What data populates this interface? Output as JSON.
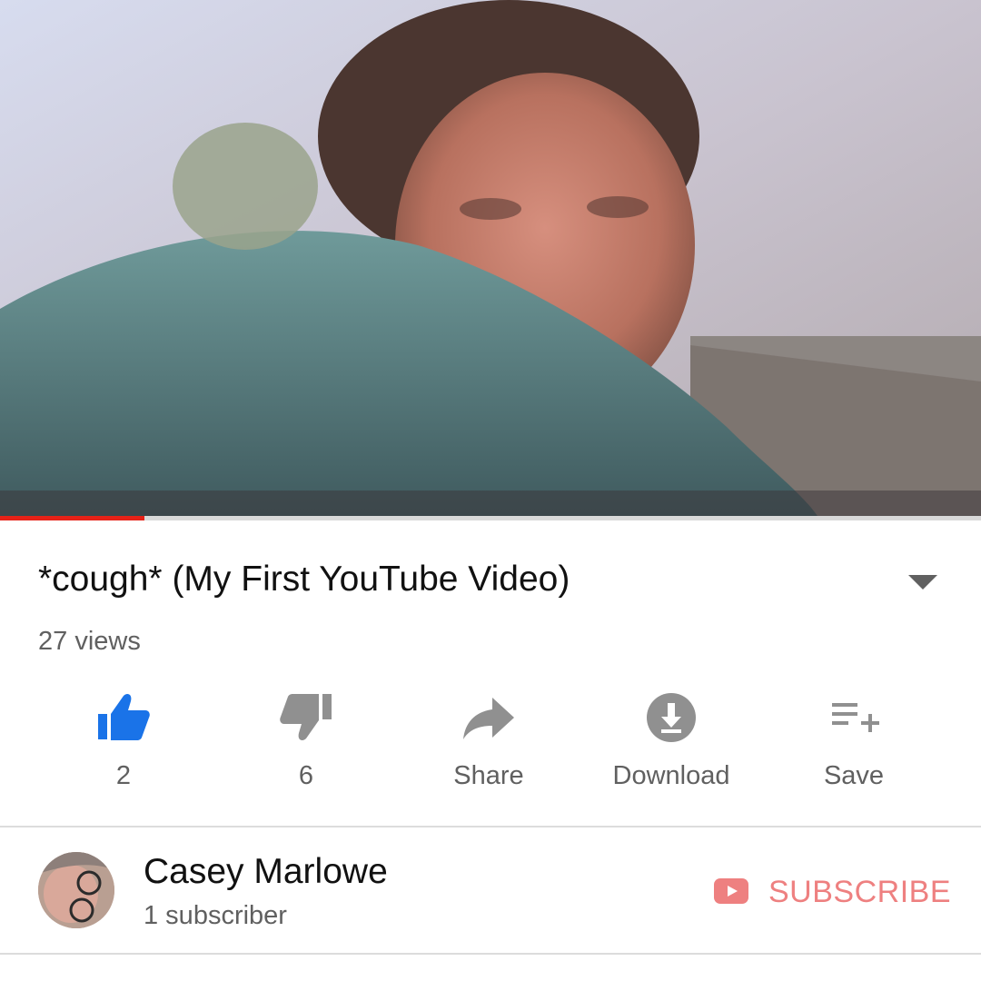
{
  "video": {
    "progress_fraction": 0.147,
    "title": "*cough* (My First YouTube Video)",
    "views": "27 views"
  },
  "actions": {
    "like": {
      "icon": "thumbs-up-icon",
      "label": "2",
      "color": "#1a73e8"
    },
    "dislike": {
      "icon": "thumbs-down-icon",
      "label": "6",
      "color": "#909090"
    },
    "share": {
      "icon": "share-arrow-icon",
      "label": "Share",
      "color": "#909090"
    },
    "download": {
      "icon": "download-icon",
      "label": "Download",
      "color": "#909090"
    },
    "save": {
      "icon": "playlist-add-icon",
      "label": "Save",
      "color": "#909090"
    }
  },
  "channel": {
    "name": "Casey Marlowe",
    "subscribers": "1 subscriber",
    "subscribe_label": "SUBSCRIBE",
    "subscribe_color": "#ee8080"
  },
  "colors": {
    "progress": "#e62117",
    "text_primary": "#111111",
    "text_secondary": "#606060"
  }
}
